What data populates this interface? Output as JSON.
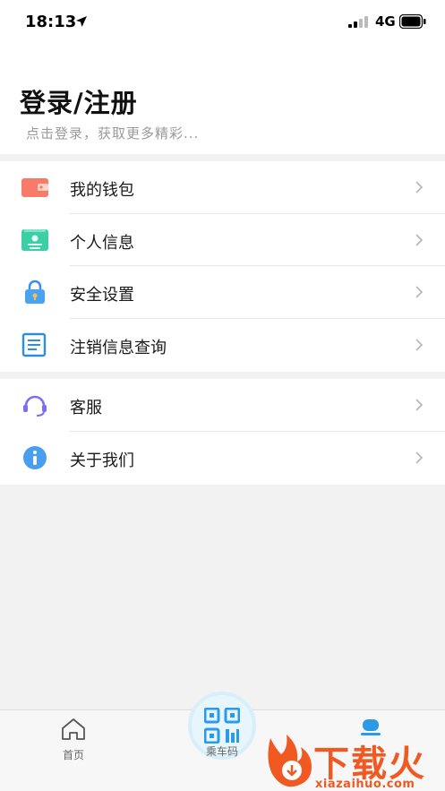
{
  "status_bar": {
    "time": "18:13",
    "network": "4G"
  },
  "header": {
    "title": "登录/注册",
    "subtitle": "点击登录，获取更多精彩..."
  },
  "menu_group_1": [
    {
      "label": "我的钱包",
      "icon": "wallet-icon"
    },
    {
      "label": "个人信息",
      "icon": "id-card-icon"
    },
    {
      "label": "安全设置",
      "icon": "lock-icon"
    },
    {
      "label": "注销信息查询",
      "icon": "document-icon"
    }
  ],
  "menu_group_2": [
    {
      "label": "客服",
      "icon": "headset-icon"
    },
    {
      "label": "关于我们",
      "icon": "info-icon"
    }
  ],
  "tabbar": {
    "home": "首页",
    "ride_code": "乘车码"
  },
  "watermark": {
    "text": "下载火",
    "url": "xiazaihuo.com"
  },
  "colors": {
    "accent_blue": "#2b9be6",
    "watermark_orange": "#f05a22"
  }
}
